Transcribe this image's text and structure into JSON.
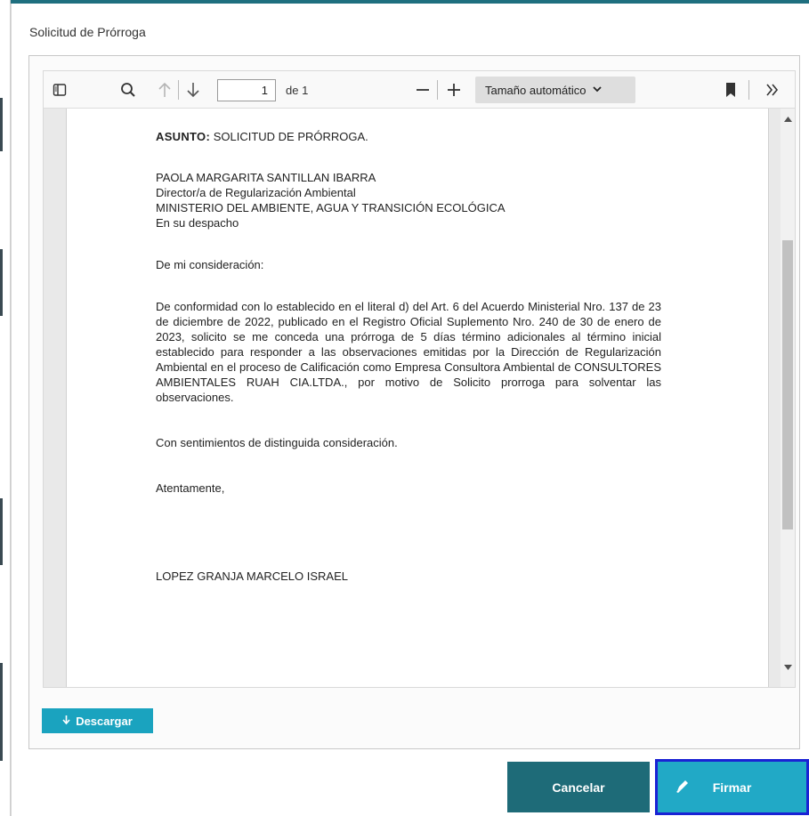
{
  "modal": {
    "title": "Solicitud de Prórroga"
  },
  "viewer_toolbar": {
    "page_number": "1",
    "page_of": "de 1",
    "zoom_label": "Tamaño automático",
    "icons": [
      "sidebar-toggle-icon",
      "search-icon",
      "arrow-up-icon",
      "arrow-down-icon",
      "zoom-out-icon",
      "zoom-in-icon",
      "chevron-down-icon",
      "bookmark-icon",
      "double-chevron-right-icon"
    ]
  },
  "document": {
    "asunto_label": "ASUNTO:",
    "asunto_text": " SOLICITUD DE PRÓRROGA.",
    "recipient_lines": [
      "PAOLA MARGARITA SANTILLAN IBARRA",
      "Director/a de Regularización Ambiental",
      "MINISTERIO DEL AMBIENTE, AGUA Y TRANSICIÓN ECOLÓGICA",
      "En su despacho"
    ],
    "greeting": "De mi consideración:",
    "body": "De conformidad con lo establecido en el literal d) del Art. 6 del Acuerdo Ministerial Nro. 137 de 23 de diciembre de 2022, publicado en el Registro Oficial Suplemento Nro. 240 de 30 de enero de 2023, solicito se me conceda una prórroga de 5 días término adicionales al término inicial establecido para responder a las observaciones emitidas por la Dirección de Regularización Ambiental en el proceso de Calificación como Empresa Consultora Ambiental de CONSULTORES AMBIENTALES RUAH CIA.LTDA., por motivo de Solicito prorroga para solventar las observaciones.",
    "closing_1": "Con sentimientos de distinguida consideración.",
    "closing_2": "Atentamente,",
    "signer": "LOPEZ GRANJA MARCELO ISRAEL"
  },
  "actions": {
    "download_label": "Descargar",
    "cancel_label": "Cancelar",
    "sign_label": "Firmar"
  },
  "colors": {
    "accent_teal": "#1e6b78",
    "button_cyan": "#21a9c6",
    "focus_outline": "#1a22d4"
  }
}
